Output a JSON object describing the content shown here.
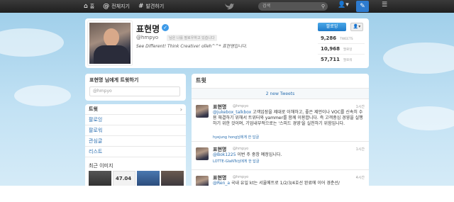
{
  "topbar": {
    "home_label": "홈",
    "connect_label": "전체지기",
    "discover_label": "발견하기",
    "search_placeholder": "검색"
  },
  "profile": {
    "name": "표현명",
    "handle": "@hmpyo",
    "follows_you": "님은 나를 팔로우하고 있습니다",
    "bio": "See Different! Think Creative! olleh^^* 표현명입니다.",
    "follow_label": "팔로잉",
    "stats": [
      {
        "value": "9,286",
        "label": "TWEETS"
      },
      {
        "value": "10,968",
        "label": "팔로잉"
      },
      {
        "value": "57,711",
        "label": "팔로워"
      }
    ]
  },
  "tweet_to": {
    "title": "표현명 님에게 트윗하기",
    "placeholder": "@hmpyo"
  },
  "side_nav": {
    "items": [
      {
        "label": "트윗"
      },
      {
        "label": "팔로잉"
      },
      {
        "label": "팔로워"
      },
      {
        "label": "관심글"
      },
      {
        "label": "리스트"
      }
    ],
    "recent_images_title": "최근 이미지",
    "thumb_text": "47.04"
  },
  "timeline": {
    "title": "트윗",
    "new_tweets": "2 new Tweets",
    "tweets": [
      {
        "name": "표현명",
        "handle": "@hmpyo",
        "time": "1시간",
        "mention": "@jukebox_talkbox",
        "text": " 고객입장을 제대로 이해하고, 좋은 제언이나 VOC를 신속히 수용 해결하기 위해서 트위터와 yammer를 함께 이용합니다. 즉 고객중심 경영을 실행하기 위한 것이며, 기업내부적으로는 '스피드 경영'을 실천하기 위함입니다.",
        "reply": "hyejung hong님에게 한 답글"
      },
      {
        "name": "표현명",
        "handle": "@hmpyo",
        "time": "1시간",
        "mention": "@Bok1225",
        "text": " 이번 주 중창 예정입니다.",
        "reply": "LOTTE-GIaNTs님에게 한 답글"
      },
      {
        "name": "표현명",
        "handle": "@hmpyo",
        "time": "4시간",
        "mention": "@Ren_a",
        "text": " 국내 유일 kt는 서울메트로 1/2/3/4호선 완료에 이어 경춘선/",
        "reply": ""
      }
    ]
  },
  "colors": {
    "accent": "#2b6fb0",
    "topbar": "#2a2a2a",
    "follow_button": "#1f7bc9",
    "sky": "#9ccde9"
  }
}
